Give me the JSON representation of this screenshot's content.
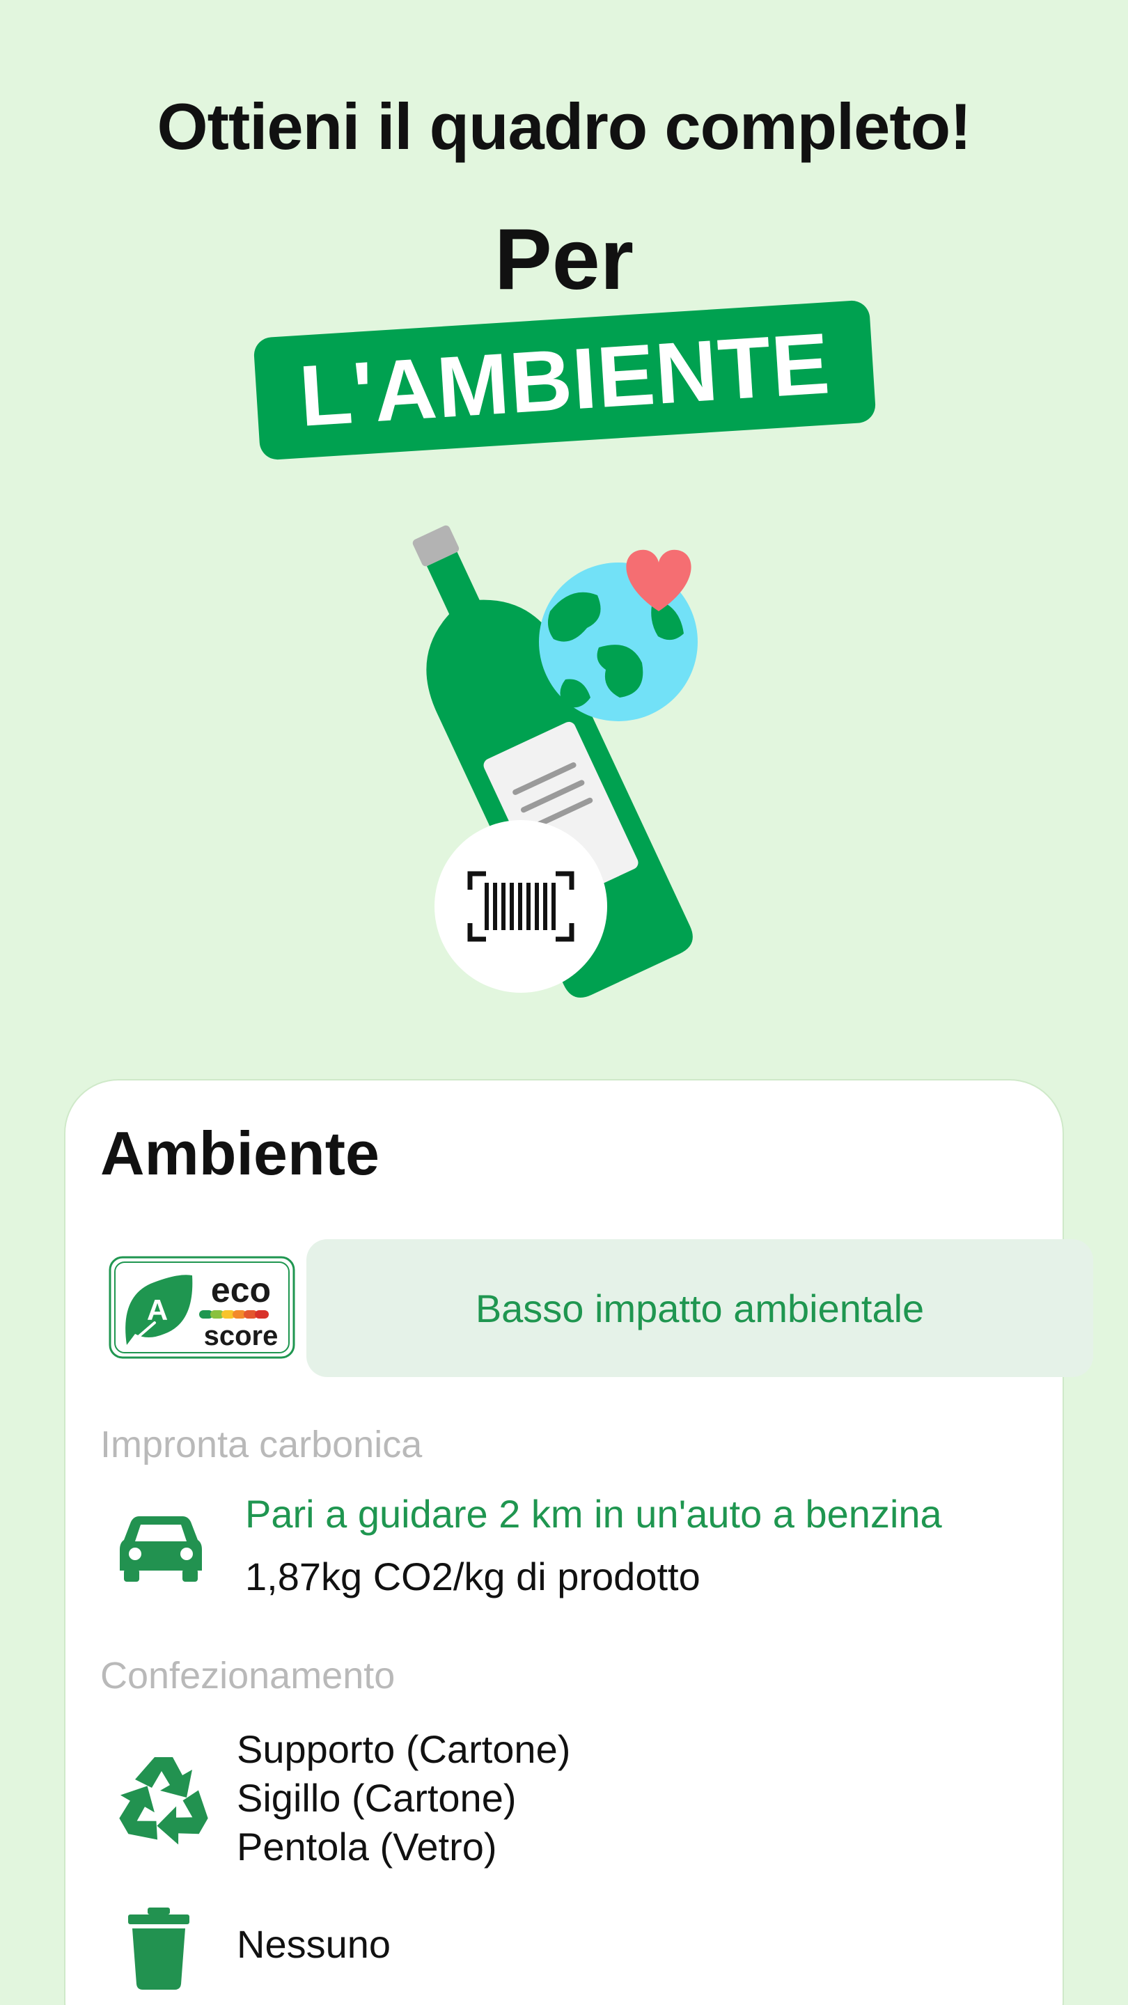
{
  "header": {
    "headline": "Ottieni il quadro completo!",
    "per": "Per",
    "banner": "L'AMBIENTE"
  },
  "colors": {
    "background": "#e2f6de",
    "brand_green": "#00a150",
    "text_green": "#1f9650",
    "pill_bg": "#e5f2e8",
    "muted_label": "#b9b9b9"
  },
  "card": {
    "title": "Ambiente",
    "ecoscore": {
      "grade": "A",
      "logo_text_top": "eco",
      "logo_text_bottom": "score",
      "description": "Basso impatto ambientale"
    },
    "carbon": {
      "label": "Impronta carbonica",
      "icon": "car-icon",
      "equivalent": "Pari a guidare 2 km in un'auto a benzina",
      "value": "1,87kg CO2/kg di prodotto"
    },
    "packaging": {
      "label": "Confezionamento",
      "recycle_icon": "recycle-icon",
      "recyclable": [
        "Supporto (Cartone)",
        "Sigillo (Cartone)",
        "Pentola (Vetro)"
      ],
      "trash_icon": "trash-icon",
      "non_recyclable": "Nessuno"
    }
  }
}
